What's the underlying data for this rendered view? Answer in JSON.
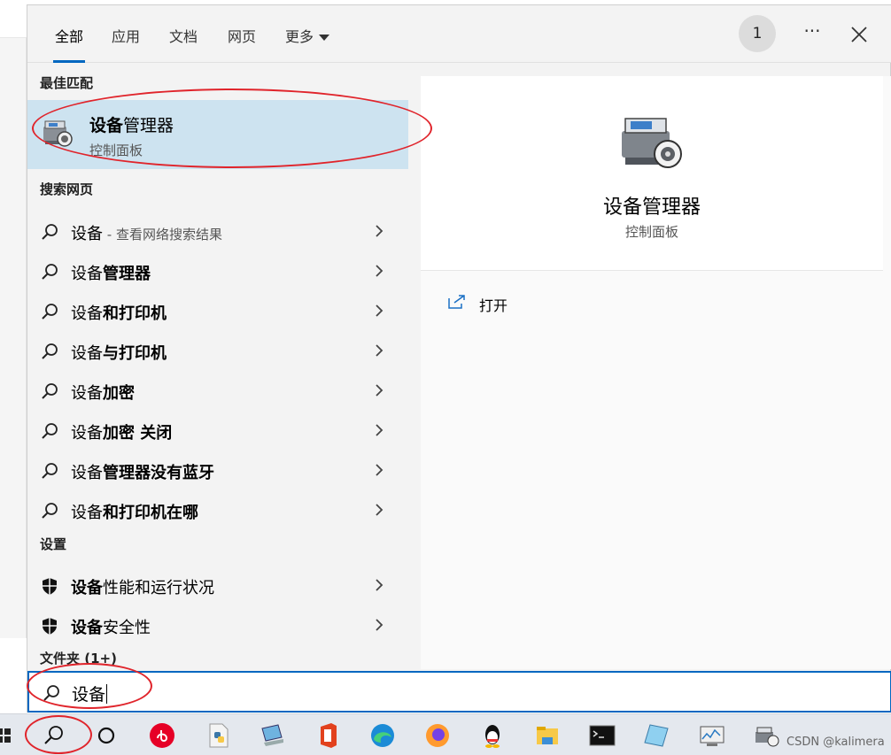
{
  "tabs": [
    {
      "label": "全部"
    },
    {
      "label": "应用"
    },
    {
      "label": "文档"
    },
    {
      "label": "网页"
    },
    {
      "label": "更多"
    }
  ],
  "account_badge": "1",
  "more_glyph": "···",
  "sections": {
    "best_match": "最佳匹配",
    "search_web": "搜索网页",
    "settings": "设置",
    "folders": "文件夹 (1+)"
  },
  "best_match": {
    "title_bold": "设备",
    "title_rest": "管理器",
    "subtitle": "控制面板"
  },
  "web_results": [
    {
      "prefix": "设备",
      "bold": "",
      "suffix": " - 查看网络搜索结果"
    },
    {
      "prefix": "设备",
      "bold": "管理器",
      "suffix": ""
    },
    {
      "prefix": "设备",
      "bold": "和打印机",
      "suffix": ""
    },
    {
      "prefix": "设备",
      "bold": "与打印机",
      "suffix": ""
    },
    {
      "prefix": "设备",
      "bold": "加密",
      "suffix": ""
    },
    {
      "prefix": "设备",
      "bold": "加密 关闭",
      "suffix": ""
    },
    {
      "prefix": "设备",
      "bold": "管理器没有蓝牙",
      "suffix": ""
    },
    {
      "prefix": "设备",
      "bold": "和打印机在哪",
      "suffix": ""
    }
  ],
  "settings_results": [
    {
      "bold": "设备",
      "rest": "性能和运行状况"
    },
    {
      "bold": "设备",
      "rest": "安全性"
    }
  ],
  "detail": {
    "title": "设备管理器",
    "subtitle": "控制面板",
    "action_open": "打开"
  },
  "search": {
    "value": "设备"
  },
  "taskbar_icons": [
    "windows-start-icon",
    "search-icon",
    "task-view-icon",
    "netease-music-icon",
    "python-file-icon",
    "computer-icon",
    "office-icon",
    "edge-icon",
    "firefox-icon",
    "qq-icon",
    "file-explorer-icon",
    "terminal-icon",
    "notepad-icon",
    "performance-monitor-icon",
    "device-manager-icon"
  ],
  "watermark": "CSDN @kalimera",
  "colors": {
    "accent": "#0067c0",
    "selection": "#cde3f0",
    "annotation": "#e0242b"
  }
}
